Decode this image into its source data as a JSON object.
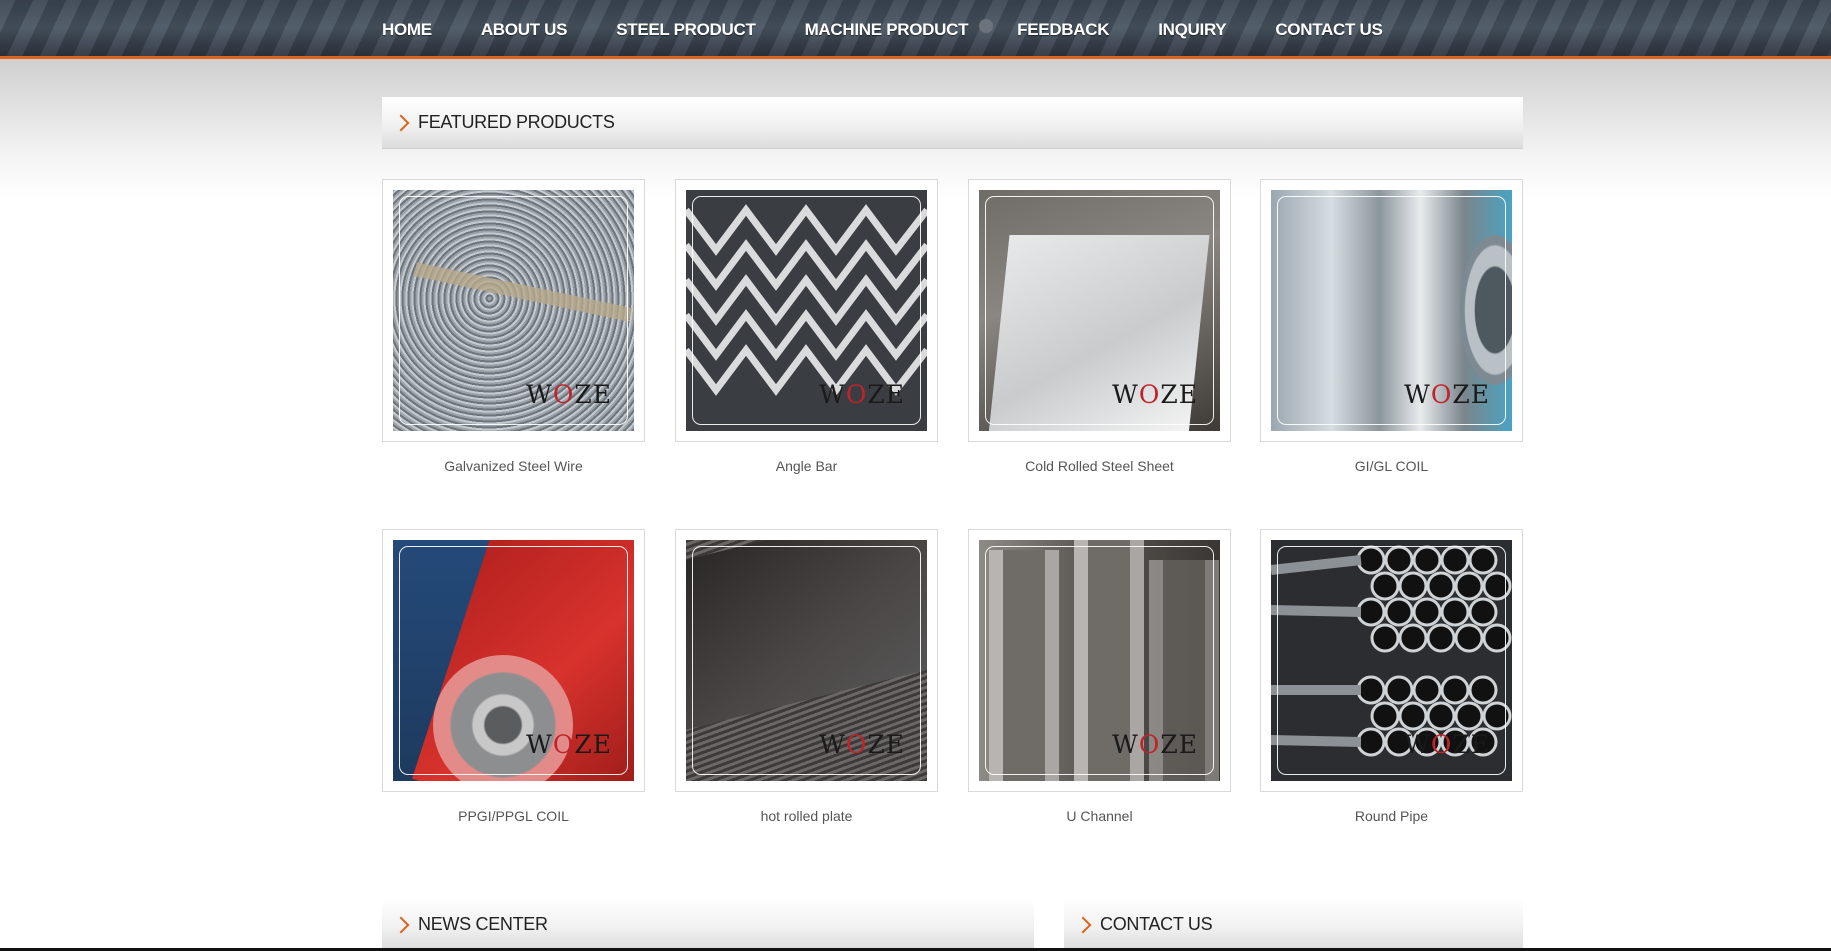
{
  "nav": {
    "items": [
      "HOME",
      "ABOUT US",
      "STEEL PRODUCT",
      "MACHINE PRODUCT",
      "FEEDBACK",
      "INQUIRY",
      "CONTACT US"
    ]
  },
  "featured": {
    "title": "FEATURED PRODUCTS",
    "products": [
      {
        "name": "Galvanized Steel Wire",
        "image_icon": "galvanized-wire-image"
      },
      {
        "name": "Angle Bar",
        "image_icon": "angle-bar-image"
      },
      {
        "name": "Cold Rolled Steel Sheet",
        "image_icon": "steel-sheet-image"
      },
      {
        "name": "GI/GL COIL",
        "image_icon": "gi-coil-image"
      },
      {
        "name": "PPGI/PPGL COIL",
        "image_icon": "ppgi-coil-image"
      },
      {
        "name": "hot rolled plate",
        "image_icon": "hot-plate-image"
      },
      {
        "name": "U Channel",
        "image_icon": "u-channel-image"
      },
      {
        "name": "Round Pipe",
        "image_icon": "round-pipe-image"
      }
    ],
    "watermark": "WOZE"
  },
  "news": {
    "title": "NEWS CENTER"
  },
  "contact": {
    "title": "CONTACT US"
  },
  "colors": {
    "accent": "#e0631c",
    "nav_bg": "#3c4754",
    "watermark_red": "#c0232a"
  }
}
